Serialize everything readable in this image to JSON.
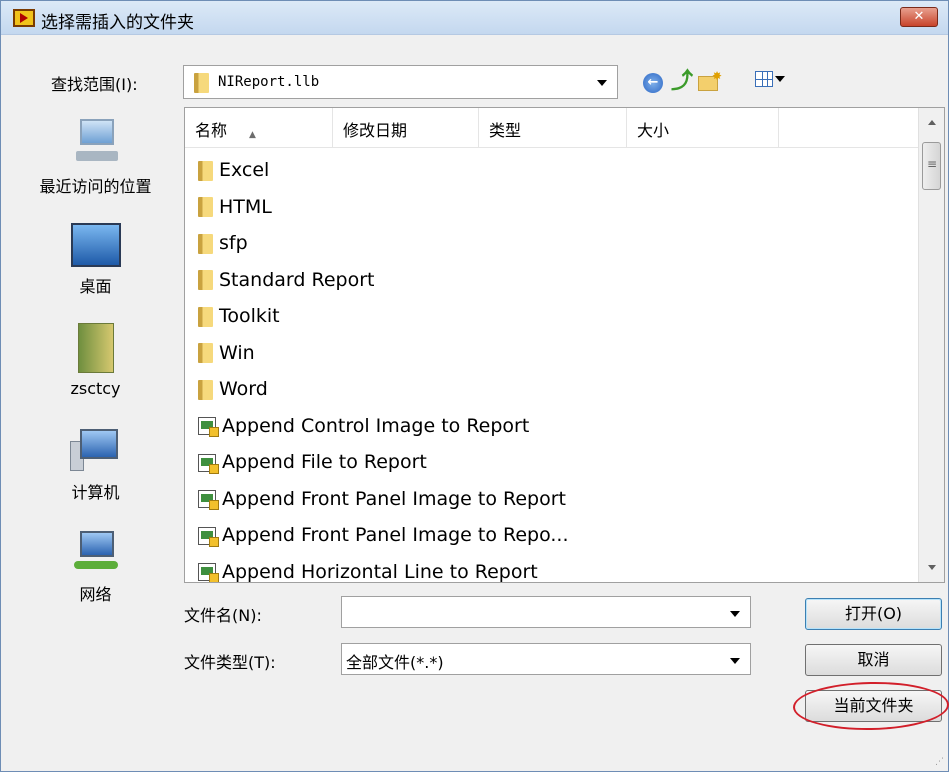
{
  "window": {
    "title": "选择需插入的文件夹",
    "close_label": "✕"
  },
  "lookin": {
    "label": "查找范围(I):",
    "value": "NIReport.llb"
  },
  "places": [
    {
      "label": "最近访问的位置",
      "icon": "recent-places-icon"
    },
    {
      "label": "桌面",
      "icon": "desktop-icon"
    },
    {
      "label": "zsctcy",
      "icon": "user-folder-icon"
    },
    {
      "label": "计算机",
      "icon": "computer-icon"
    },
    {
      "label": "网络",
      "icon": "network-icon"
    }
  ],
  "columns": {
    "name": "名称",
    "date": "修改日期",
    "type": "类型",
    "size": "大小"
  },
  "items": [
    {
      "name": "Excel",
      "kind": "folder"
    },
    {
      "name": "HTML",
      "kind": "folder"
    },
    {
      "name": "sfp",
      "kind": "folder"
    },
    {
      "name": "Standard Report",
      "kind": "folder"
    },
    {
      "name": "Toolkit",
      "kind": "folder"
    },
    {
      "name": "Win",
      "kind": "folder"
    },
    {
      "name": "Word",
      "kind": "folder"
    },
    {
      "name": "Append Control Image to Report",
      "kind": "vi"
    },
    {
      "name": "Append File to Report",
      "kind": "vi"
    },
    {
      "name": "Append Front Panel Image to Report",
      "kind": "vi"
    },
    {
      "name": "Append Front Panel Image to Repo...",
      "kind": "vi"
    },
    {
      "name": "Append Horizontal Line to Report",
      "kind": "vi"
    }
  ],
  "filename": {
    "label": "文件名(N):",
    "value": ""
  },
  "filetype": {
    "label": "文件类型(T):",
    "value": "全部文件(*.*)"
  },
  "buttons": {
    "open": "打开(O)",
    "cancel": "取消",
    "current_folder": "当前文件夹"
  },
  "colors": {
    "annotation": "#d21f2a",
    "titlebar": "#c4d8ef"
  }
}
